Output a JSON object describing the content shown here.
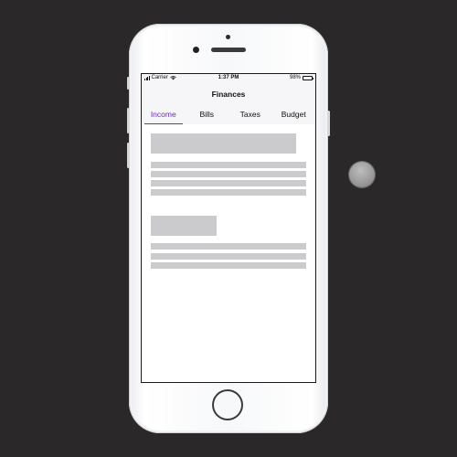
{
  "status_bar": {
    "carrier": "Carrier",
    "time": "1:37 PM",
    "battery": "98%",
    "battery_level": 0.98
  },
  "nav": {
    "title": "Finances"
  },
  "tabs": [
    {
      "label": "Income",
      "active": true
    },
    {
      "label": "Bills",
      "active": false
    },
    {
      "label": "Taxes",
      "active": false
    },
    {
      "label": "Budget",
      "active": false
    }
  ],
  "colors": {
    "accent": "#6b2fc0",
    "background": "#2a2828",
    "placeholder": "#cbcacc"
  },
  "icons": {
    "signal": "signal-bars-icon",
    "wifi": "wifi-icon",
    "battery": "battery-icon",
    "home": "home-button-icon"
  }
}
